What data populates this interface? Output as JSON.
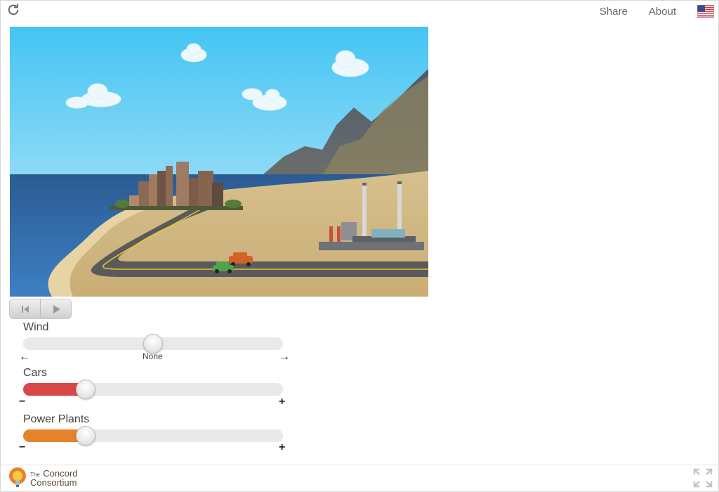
{
  "header": {
    "reload_icon": "reload-icon",
    "links": [
      "Share",
      "About"
    ],
    "language_icon": "us-flag-icon"
  },
  "playback": {
    "reset_icon": "step-back-icon",
    "play_icon": "play-icon"
  },
  "sliders": {
    "wind": {
      "label": "Wind",
      "value_label": "None",
      "left_symbol": "←",
      "right_symbol": "→",
      "value": 0.5
    },
    "cars": {
      "label": "Cars",
      "left_symbol": "−",
      "right_symbol": "+",
      "value": 0.22,
      "color": "#d9474a"
    },
    "power_plants": {
      "label": "Power Plants",
      "left_symbol": "−",
      "right_symbol": "+",
      "value": 0.22,
      "color": "#e5832a"
    }
  },
  "footer": {
    "logo_the": "The",
    "logo_line1": "Concord",
    "logo_line2": "Consortium",
    "fullscreen_icon": "fullscreen-icon"
  }
}
